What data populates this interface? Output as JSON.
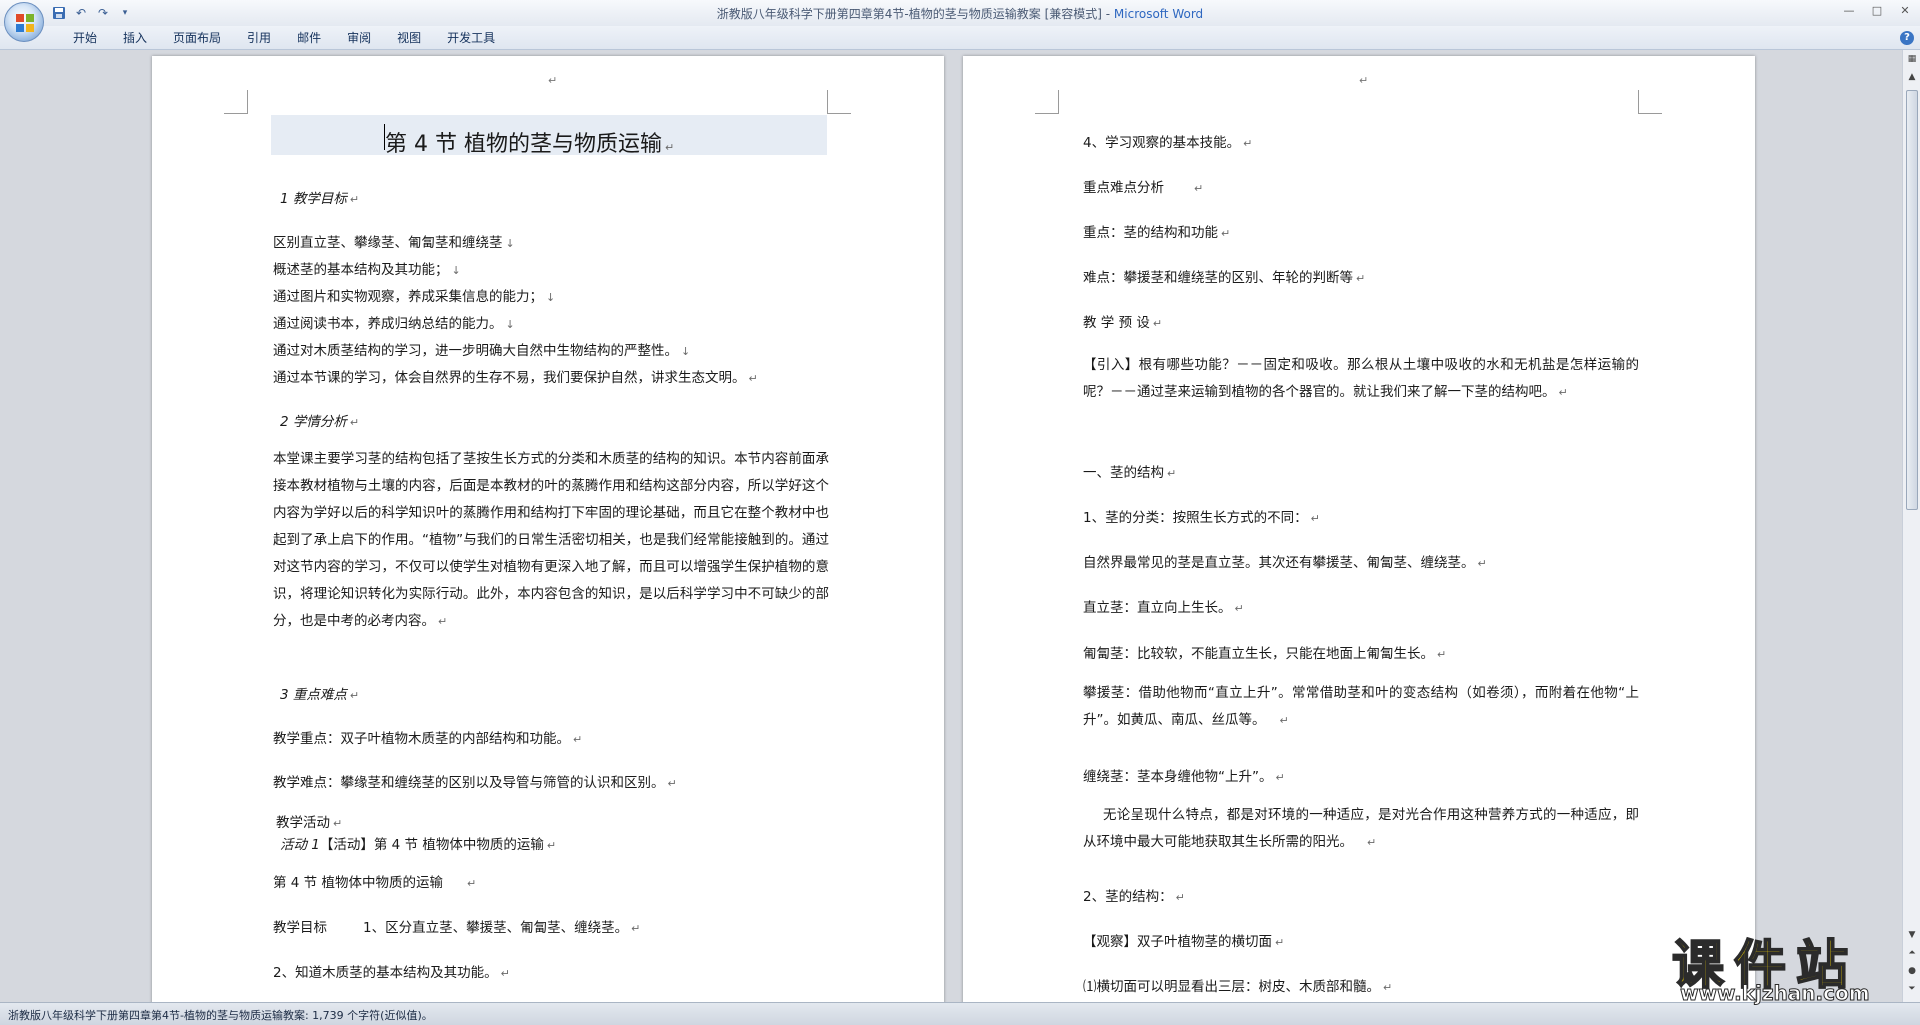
{
  "window": {
    "title": "浙教版八年级科学下册第四章第4节-植物的茎与物质运输教案 [兼容模式] - ",
    "app_name": "Microsoft Word"
  },
  "ribbon": {
    "tabs": [
      "开始",
      "插入",
      "页面布局",
      "引用",
      "邮件",
      "审阅",
      "视图",
      "开发工具"
    ]
  },
  "left_page": {
    "title": "第 4 节   植物的茎与物质运输",
    "sec1_heading": "1 教学目标",
    "goals": [
      "区别直立茎、攀缘茎、匍匐茎和缠绕茎",
      "概述茎的基本结构及其功能；",
      "通过图片和实物观察，养成采集信息的能力；",
      "通过阅读书本，养成归纳总结的能力。",
      "通过对木质茎结构的学习，进一步明确大自然中生物结构的严整性。",
      "通过本节课的学习，体会自然界的生存不易，我们要保护自然，讲求生态文明。"
    ],
    "sec2_heading": "2 学情分析",
    "analysis": "本堂课主要学习茎的结构包括了茎按生长方式的分类和木质茎的结构的知识。本节内容前面承接本教材植物与土壤的内容，后面是本教材的叶的蒸腾作用和结构这部分内容，所以学好这个内容为学好以后的科学知识叶的蒸腾作用和结构打下牢固的理论基础，而且它在整个教材中也起到了承上启下的作用。“植物”与我们的日常生活密切相关，也是我们经常能接触到的。通过对这节内容的学习，不仅可以使学生对植物有更深入地了解，而且可以增强学生保护植物的意识，将理论知识转化为实际行动。此外，本内容包含的知识，是以后科学学习中不可缺少的部分，也是中考的必考内容。",
    "sec3_heading": "3 重点难点",
    "key_point": "教学重点：双子叶植物木质茎的内部结构和功能。",
    "difficulty": "教学难点：攀缘茎和缠绕茎的区别以及导管与筛管的认识和区别。",
    "activity_heading": "教学活动",
    "activity_label": "活动 1",
    "activity_text": "【活动】第 4 节       植物体中物质的运输",
    "section_title": "第 4 节   植物体中物质的运输",
    "goal_line_label": "教学目标",
    "goal_line_text": "1、区分直立茎、攀援茎、匍匐茎、缠绕茎。",
    "goal_line2": "2、知道木质茎的基本结构及其功能。"
  },
  "right_page": {
    "p1": "4、学习观察的基本技能。",
    "p2": "重点难点分析",
    "p3": "重点：茎的结构和功能",
    "p4": "难点：攀援茎和缠绕茎的区别、年轮的判断等",
    "p5": "教 学 预 设",
    "p6": "【引入】根有哪些功能？－－固定和吸收。那么根从土壤中吸收的水和无机盐是怎样运输的呢？－－通过茎来运输到植物的各个器官的。就让我们来了解一下茎的结构吧。",
    "p7": "一、茎的结构",
    "p8": "1、茎的分类：按照生长方式的不同：",
    "p9": "自然界最常见的茎是直立茎。其次还有攀援茎、匍匐茎、缠绕茎。",
    "p10": "直立茎：直立向上生长。",
    "p11": "匍匐茎：比较软，不能直立生长，只能在地面上匍匐生长。",
    "p12": "攀援茎：借助他物而“直立上升”。常常借助茎和叶的变态结构（如卷须），而附着在他物“上升”。如黄瓜、南瓜、丝瓜等。",
    "p13": "缠绕茎：茎本身缠他物“上升”。",
    "p14": "无论呈现什么特点，都是对环境的一种适应，是对光合作用这种营养方式的一种适应，即从环境中最大可能地获取其生长所需的阳光。",
    "p15": "2、茎的结构：",
    "p16": "【观察】双子叶植物茎的横切面",
    "p17": "⑴横切面可以明显看出三层：树皮、木质部和髓。"
  },
  "statusbar": {
    "text": "浙教版八年级科学下册第四章第4节-植物的茎与物质运输教案: 1,739 个字符(近似值)。"
  },
  "watermark": {
    "main": "课件站",
    "sub": "www.kjzhan.com"
  }
}
